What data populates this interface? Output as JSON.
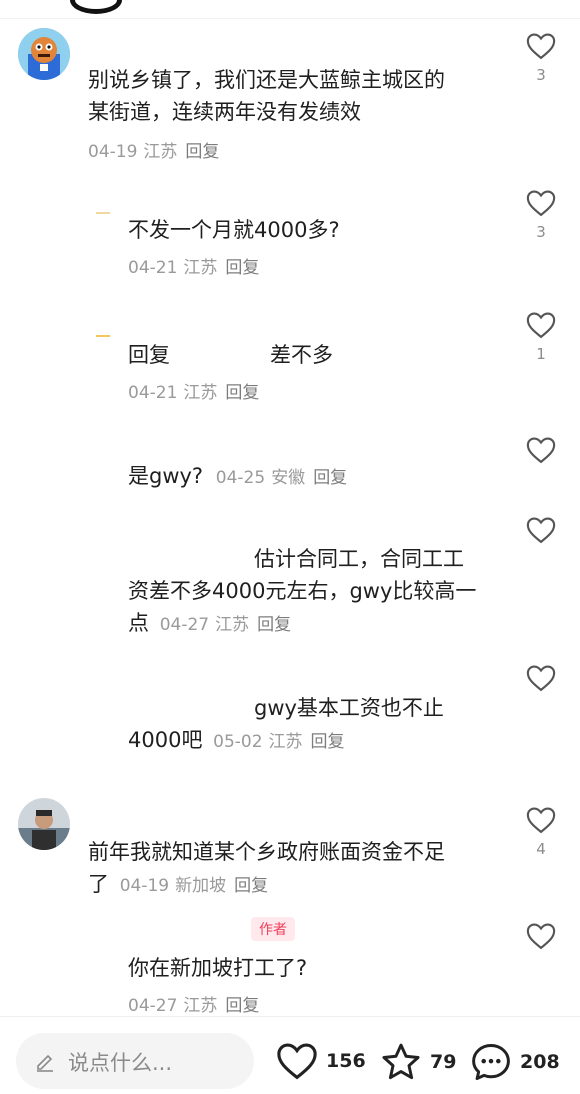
{
  "comments": [
    {
      "text_line1": "别说乡镇了，我们还是大蓝鲸主城区的",
      "text_line2": "某街道，连续两年没有发绩效",
      "date": "04-19",
      "location": "江苏",
      "reply": "回复",
      "likes": "3"
    },
    {
      "text": "不发一个月就4000多?",
      "date": "04-21",
      "location": "江苏",
      "reply": "回复",
      "likes": "3"
    },
    {
      "text_prefix": "回复",
      "text_suffix": "差不多",
      "date": "04-21",
      "location": "江苏",
      "reply": "回复",
      "likes": "1"
    },
    {
      "text": "是gwy?",
      "date": "04-25",
      "location": "安徽",
      "reply": "回复",
      "likes": ""
    },
    {
      "text_line1": "估计合同工，合同工工",
      "text_line2": "资差不多4000元左右，gwy比较高一",
      "text_line3": "点",
      "date": "04-27",
      "location": "江苏",
      "reply": "回复",
      "likes": ""
    },
    {
      "text_line1": "gwy基本工资也不止",
      "text_line2": "4000吧",
      "date": "05-02",
      "location": "江苏",
      "reply": "回复",
      "likes": ""
    },
    {
      "text_line1": "前年我就知道某个乡政府账面资金不足",
      "text_line2": "了",
      "date": "04-19",
      "location": "新加坡",
      "reply": "回复",
      "likes": "4"
    },
    {
      "author_tag": "作者",
      "text": "你在新加坡打工了?",
      "date": "04-27",
      "location": "江苏",
      "reply": "回复",
      "likes": ""
    }
  ],
  "bottom": {
    "placeholder": "说点什么...",
    "likes": "156",
    "favorites": "79",
    "comments": "208"
  }
}
